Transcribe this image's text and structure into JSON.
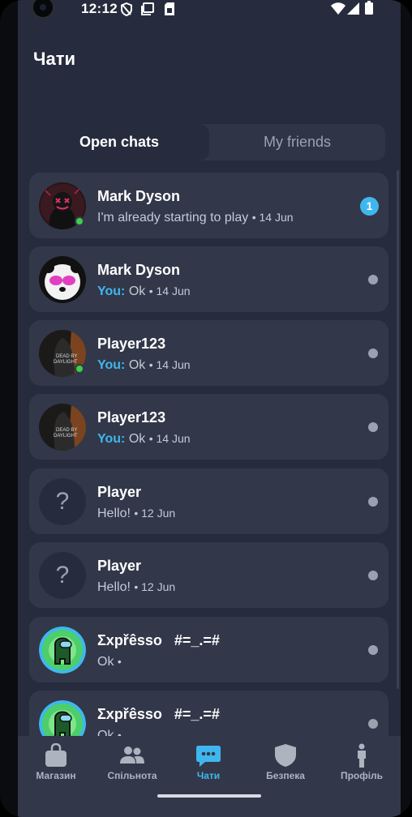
{
  "status_bar": {
    "time": "12:12"
  },
  "header": {
    "title": "Чати"
  },
  "tabs": [
    {
      "label": "Open chats",
      "active": true
    },
    {
      "label": "My friends",
      "active": false
    }
  ],
  "chats": [
    {
      "name": "Mark Dyson",
      "preview": "I'm already starting to play",
      "you": "",
      "date": "• 14 Jun",
      "avatar": "masked-figure-avatar",
      "online": true,
      "unread": "1"
    },
    {
      "name": "Mark Dyson",
      "preview": "Ok",
      "you": "You:",
      "date": "• 14 Jun",
      "avatar": "panda-avatar",
      "online": false,
      "unread": ""
    },
    {
      "name": "Player123",
      "preview": "Ok",
      "you": "You:",
      "date": "• 14 Jun",
      "avatar": "dead-by-daylight-avatar",
      "online": true,
      "unread": ""
    },
    {
      "name": "Player123",
      "preview": "Ok",
      "you": "You:",
      "date": "• 14 Jun",
      "avatar": "dead-by-daylight-avatar",
      "online": false,
      "unread": ""
    },
    {
      "name": "Player",
      "preview": "Hello!",
      "you": "",
      "date": "• 12 Jun",
      "avatar": "question-mark-avatar",
      "online": false,
      "unread": ""
    },
    {
      "name": "Player",
      "preview": "Hello!",
      "you": "",
      "date": "• 12 Jun",
      "avatar": "question-mark-avatar",
      "online": false,
      "unread": ""
    },
    {
      "name": "Σxpřêsso   #=_.=#",
      "preview": "Ok",
      "you": "",
      "date": "•",
      "avatar": "among-us-avatar",
      "online": false,
      "unread": ""
    },
    {
      "name": "Σxpřêsso   #=_.=#",
      "preview": "Ok",
      "you": "",
      "date": "•",
      "avatar": "among-us-avatar",
      "online": false,
      "unread": ""
    }
  ],
  "question_mark": "?",
  "avatar_text": {
    "dbd_line1": "DEAD BY",
    "dbd_line2": "DAYLIGHT"
  },
  "bottom_nav": [
    {
      "label": "Магазин",
      "icon": "shopping-bag-icon",
      "active": false
    },
    {
      "label": "Спільнота",
      "icon": "community-icon",
      "active": false
    },
    {
      "label": "Чати",
      "icon": "chat-bubble-icon",
      "active": true
    },
    {
      "label": "Безпека",
      "icon": "shield-icon",
      "active": false
    },
    {
      "label": "Профіль",
      "icon": "person-icon",
      "active": false
    }
  ],
  "colors": {
    "background": "#262c3d",
    "card": "#323849",
    "accent": "#3fb7ee",
    "online": "#3ecf4a"
  }
}
